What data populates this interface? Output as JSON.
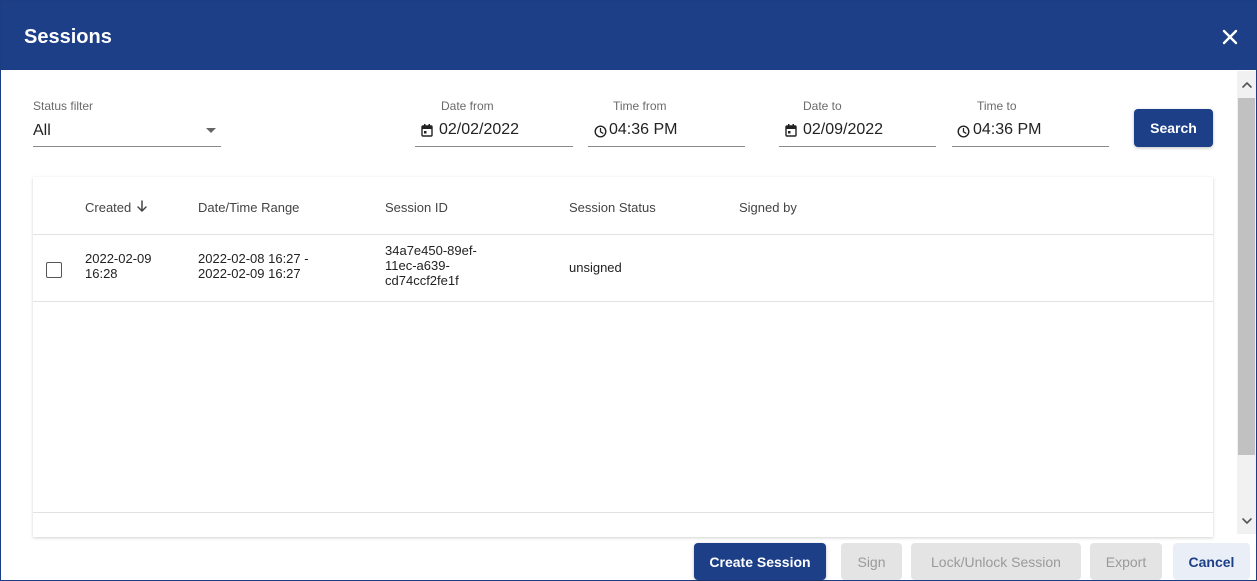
{
  "dialog": {
    "title": "Sessions",
    "close_icon": "close-icon"
  },
  "filters": {
    "status": {
      "label": "Status filter",
      "value": "All"
    },
    "date_from": {
      "label": "Date from",
      "value": "02/02/2022",
      "icon": "calendar-icon"
    },
    "time_from": {
      "label": "Time from",
      "value": "04:36 PM",
      "icon": "clock-icon"
    },
    "date_to": {
      "label": "Date to",
      "value": "02/09/2022",
      "icon": "calendar-icon"
    },
    "time_to": {
      "label": "Time to",
      "value": "04:36 PM",
      "icon": "clock-icon"
    },
    "search_label": "Search"
  },
  "table": {
    "columns": [
      "Created",
      "Date/Time Range",
      "Session ID",
      "Session Status",
      "Signed by"
    ],
    "sort_icon": "arrow-down-icon",
    "rows": [
      {
        "created_line1": "2022-02-09",
        "created_line2": "16:28",
        "range_line1": "2022-02-08 16:27 -",
        "range_line2": "2022-02-09 16:27",
        "session_id_line1": "34a7e450-89ef-",
        "session_id_line2": "11ec-a639-",
        "session_id_line3": "cd74ccf2fe1f",
        "status": "unsigned",
        "signed_by": ""
      }
    ]
  },
  "footer": {
    "create_session": "Create Session",
    "sign": "Sign",
    "lock_unlock": "Lock/Unlock Session",
    "export": "Export",
    "cancel": "Cancel"
  },
  "colors": {
    "primary": "#1c3f88",
    "disabled_bg": "#e4e4e4",
    "disabled_text": "#9a9a9a"
  }
}
